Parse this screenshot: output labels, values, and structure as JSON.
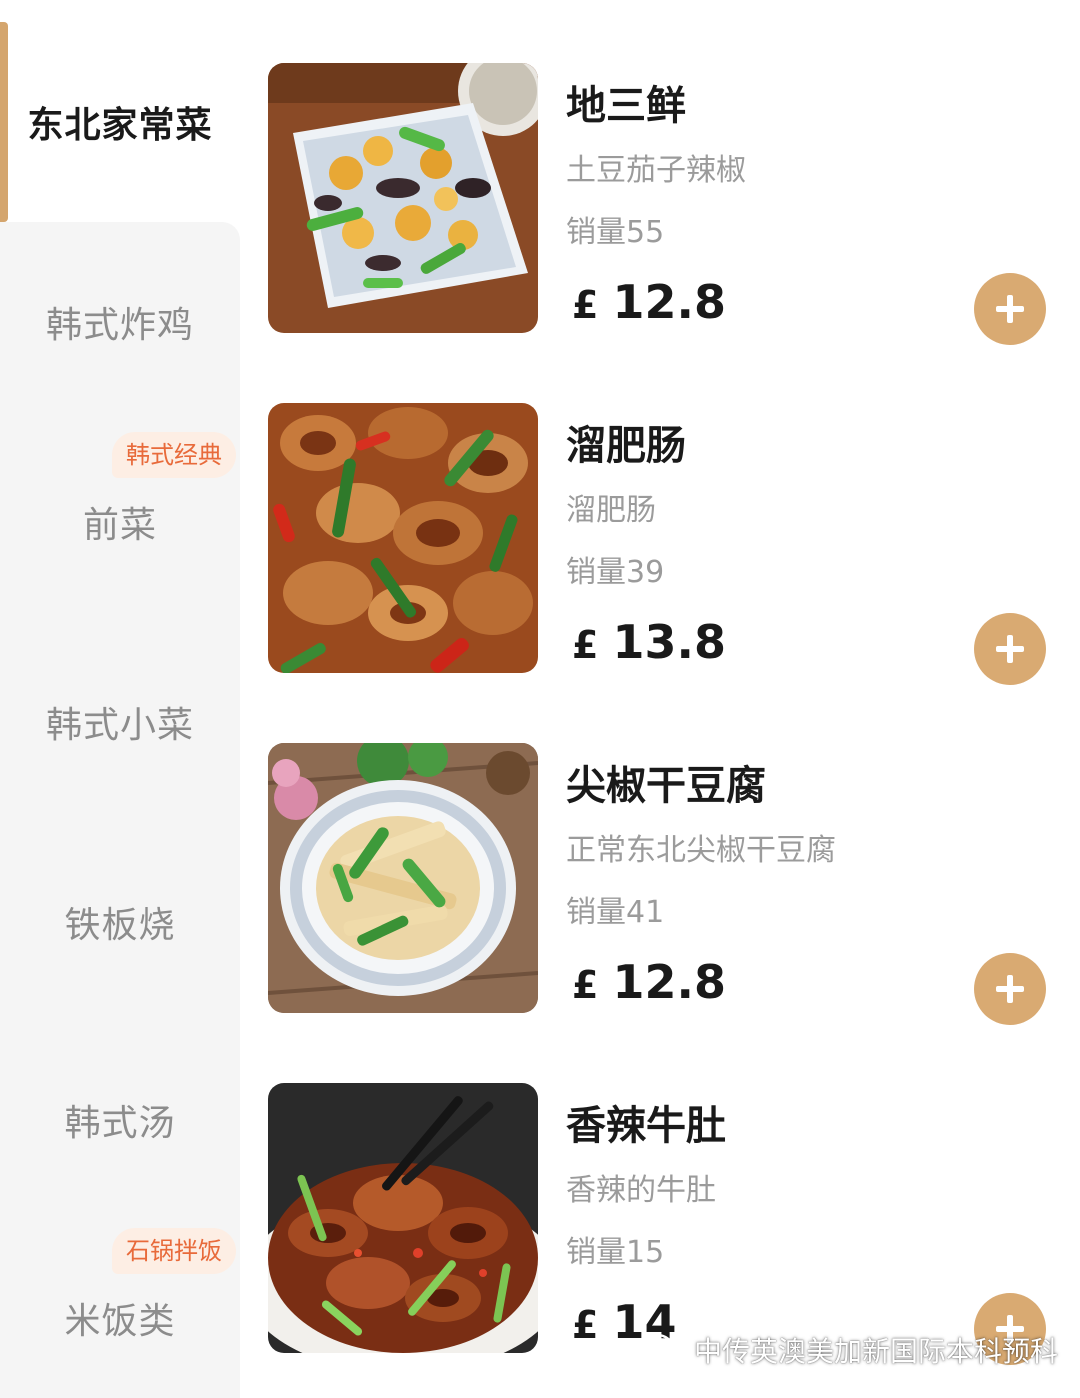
{
  "sidebar": {
    "items": [
      {
        "label": "东北家常菜",
        "active": true
      },
      {
        "label": "韩式炸鸡"
      },
      {
        "label": "前菜",
        "badge": "韩式经典"
      },
      {
        "label": "韩式小菜"
      },
      {
        "label": "铁板烧"
      },
      {
        "label": "韩式汤"
      },
      {
        "label": "米饭类",
        "badge": "石锅拌饭"
      }
    ]
  },
  "dishes": [
    {
      "name": "地三鲜",
      "desc": "土豆茄子辣椒",
      "sales": "销量55",
      "currency": "£",
      "price": "12.8"
    },
    {
      "name": "溜肥肠",
      "desc": "溜肥肠",
      "sales": "销量39",
      "currency": "£",
      "price": "13.8"
    },
    {
      "name": "尖椒干豆腐",
      "desc": "正常东北尖椒干豆腐",
      "sales": "销量41",
      "currency": "£",
      "price": "12.8"
    },
    {
      "name": "香辣牛肚",
      "desc": "香辣的牛肚",
      "sales": "销量15",
      "currency": "£",
      "price": "14"
    }
  ],
  "watermark": {
    "text": "中传英澳美加新国际本科预科"
  },
  "colors": {
    "accent": "#d9aa72",
    "badge_text": "#e86a3a",
    "sidebar_bg": "#f5f5f5"
  },
  "icons": {
    "add": "plus-icon",
    "watermark": "wechat-icon"
  }
}
